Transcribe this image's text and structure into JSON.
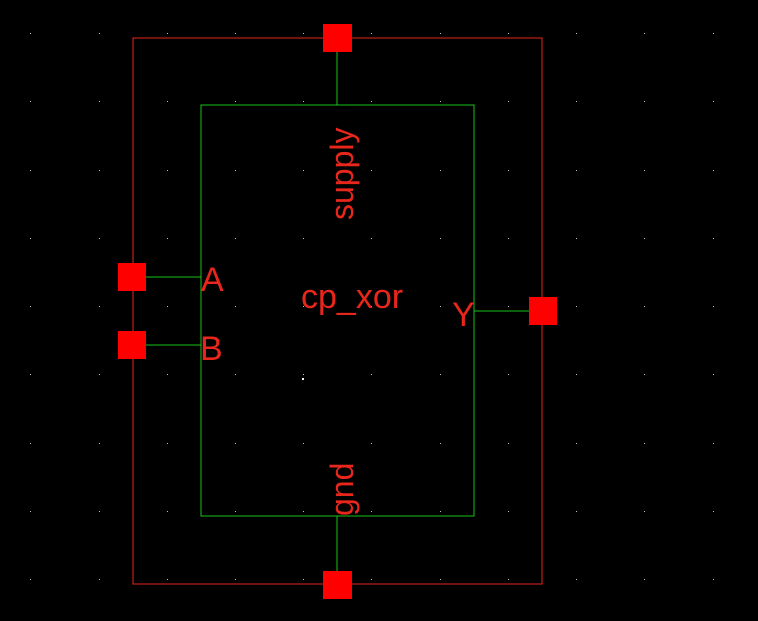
{
  "symbol": {
    "cell_name": "cp_xor",
    "pins": {
      "top": "supply",
      "bottom": "gnd",
      "left_a": "A",
      "left_b": "B",
      "right_y": "Y"
    }
  },
  "colors": {
    "background": "#000000",
    "grid_dot": "#bdbdbd",
    "selection_box": "#e8261c",
    "symbol_body": "#19c419",
    "pin_wire": "#19c419",
    "pin_square": "#ff0000",
    "label_text": "#e8261c",
    "origin_dot": "#ffffff"
  }
}
